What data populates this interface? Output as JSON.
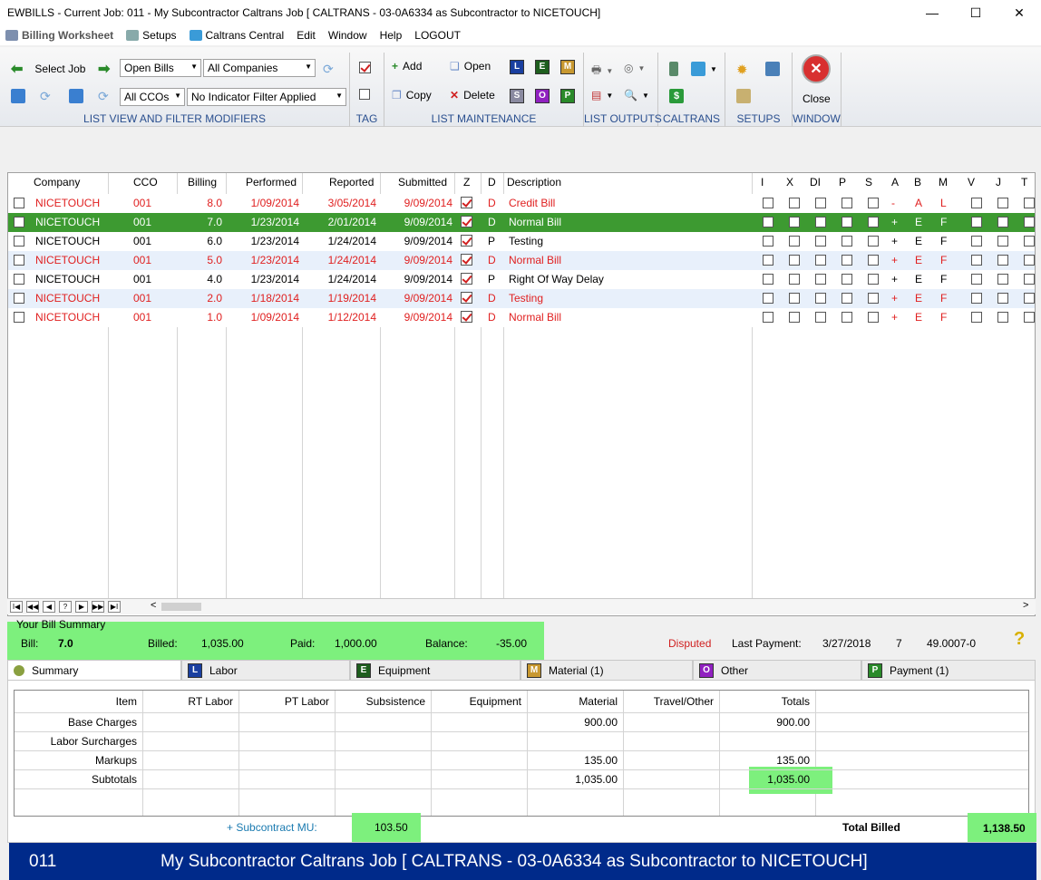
{
  "window": {
    "title": "EWBILLS - Current Job: 011 - My Subcontractor Caltrans Job  [ CALTRANS - 03-0A6334 as Subcontractor to NICETOUCH]",
    "min": "—",
    "max": "☐",
    "close": "✕"
  },
  "menu": {
    "billing_worksheet": "Billing Worksheet",
    "setups": "Setups",
    "caltrans_central": "Caltrans Central",
    "edit": "Edit",
    "window": "Window",
    "help": "Help",
    "logout": "LOGOUT"
  },
  "ribbon": {
    "select_job": "Select Job",
    "open_bills": "Open Bills",
    "all_companies": "All Companies",
    "all_ccos": "All CCOs",
    "indicator_filter": "No Indicator Filter Applied",
    "list_view_caption": "LIST VIEW AND FILTER MODIFIERS",
    "tag_caption": "TAG",
    "add": "Add",
    "copy": "Copy",
    "open": "Open",
    "delete": "Delete",
    "letters": [
      "L",
      "E",
      "M",
      "S",
      "O",
      "P"
    ],
    "list_maintenance_caption": "LIST MAINTENANCE",
    "list_outputs_caption": "LIST OUTPUTS",
    "caltrans_caption": "CALTRANS",
    "setups_caption": "SETUPS",
    "close": "Close",
    "window_caption": "WINDOW"
  },
  "grid": {
    "headers": {
      "company": "Company",
      "cco": "CCO",
      "billing": "Billing",
      "performed": "Performed",
      "reported": "Reported",
      "submitted": "Submitted",
      "z": "Z",
      "d": "D",
      "description": "Description",
      "i": "I",
      "x": "X",
      "di": "DI",
      "p": "P",
      "s": "S",
      "a": "A",
      "b": "B",
      "m": "M",
      "v": "V",
      "j": "J",
      "t": "T"
    },
    "rows": [
      {
        "company": "NICETOUCH",
        "cco": "001",
        "billing": "8.0",
        "performed": "1/09/2014",
        "reported": "3/05/2014",
        "submitted": "9/09/2014",
        "d": "D",
        "description": "Credit Bill",
        "a": "-",
        "b": "A",
        "m": "L",
        "style": "red"
      },
      {
        "company": "NICETOUCH",
        "cco": "001",
        "billing": "7.0",
        "performed": "1/23/2014",
        "reported": "2/01/2014",
        "submitted": "9/09/2014",
        "d": "D",
        "description": "Normal Bill",
        "a": "+",
        "b": "E",
        "m": "F",
        "style": "selected"
      },
      {
        "company": "NICETOUCH",
        "cco": "001",
        "billing": "6.0",
        "performed": "1/23/2014",
        "reported": "1/24/2014",
        "submitted": "9/09/2014",
        "d": "P",
        "description": "Testing",
        "a": "+",
        "b": "E",
        "m": "F",
        "style": "black"
      },
      {
        "company": "NICETOUCH",
        "cco": "001",
        "billing": "5.0",
        "performed": "1/23/2014",
        "reported": "1/24/2014",
        "submitted": "9/09/2014",
        "d": "D",
        "description": "Normal Bill",
        "a": "+",
        "b": "E",
        "m": "F",
        "style": "red-alt"
      },
      {
        "company": "NICETOUCH",
        "cco": "001",
        "billing": "4.0",
        "performed": "1/23/2014",
        "reported": "1/24/2014",
        "submitted": "9/09/2014",
        "d": "P",
        "description": "Right Of Way Delay",
        "a": "+",
        "b": "E",
        "m": "F",
        "style": "black"
      },
      {
        "company": "NICETOUCH",
        "cco": "001",
        "billing": "2.0",
        "performed": "1/18/2014",
        "reported": "1/19/2014",
        "submitted": "9/09/2014",
        "d": "D",
        "description": "Testing",
        "a": "+",
        "b": "E",
        "m": "F",
        "style": "red-alt"
      },
      {
        "company": "NICETOUCH",
        "cco": "001",
        "billing": "1.0",
        "performed": "1/09/2014",
        "reported": "1/12/2014",
        "submitted": "9/09/2014",
        "d": "D",
        "description": "Normal Bill",
        "a": "+",
        "b": "E",
        "m": "F",
        "style": "red"
      }
    ]
  },
  "nav": {
    "first": "I◀",
    "prev_page": "◀◀",
    "prev": "◀",
    "help": "?",
    "next": "▶",
    "next_page": "▶▶",
    "last": "▶I"
  },
  "bill_summary": {
    "heading": "Your Bill Summary",
    "bill_label": "Bill:",
    "bill_value": "7.0",
    "billed_label": "Billed:",
    "billed_value": "1,035.00",
    "paid_label": "Paid:",
    "paid_value": "1,000.00",
    "balance_label": "Balance:",
    "balance_value": "-35.00",
    "disputed": "Disputed",
    "last_payment_label": "Last Payment:",
    "last_payment_date": "3/27/2018",
    "last_payment_num": "7",
    "last_payment_ref": "49.0007-0",
    "help_icon": "?"
  },
  "tabs": [
    {
      "label": "Summary",
      "letter": ""
    },
    {
      "label": "Labor",
      "letter": "L"
    },
    {
      "label": "Equipment",
      "letter": "E"
    },
    {
      "label": "Material (1)",
      "letter": "M"
    },
    {
      "label": "Other",
      "letter": "O"
    },
    {
      "label": "Payment (1)",
      "letter": "P"
    }
  ],
  "summary_table": {
    "columns": [
      "Item",
      "RT Labor",
      "PT Labor",
      "Subsistence",
      "Equipment",
      "Material",
      "Travel/Other",
      "Totals"
    ],
    "rows": [
      {
        "item": "Base Charges",
        "material": "900.00",
        "totals": "900.00"
      },
      {
        "item": "Labor Surcharges",
        "material": "",
        "totals": ""
      },
      {
        "item": "Markups",
        "material": "135.00",
        "totals": "135.00"
      },
      {
        "item": "Subtotals",
        "material": "1,035.00",
        "totals": "1,035.00"
      }
    ],
    "subcontract_mu_label": "+ Subcontract MU:",
    "subcontract_mu_value": "103.50",
    "total_billed_label": "Total Billed",
    "total_billed_value": "1,138.50"
  },
  "status": {
    "job_number": "011",
    "job_text": "My Subcontractor Caltrans Job  [ CALTRANS - 03-0A6334 as Subcontractor to NICETOUCH]"
  }
}
